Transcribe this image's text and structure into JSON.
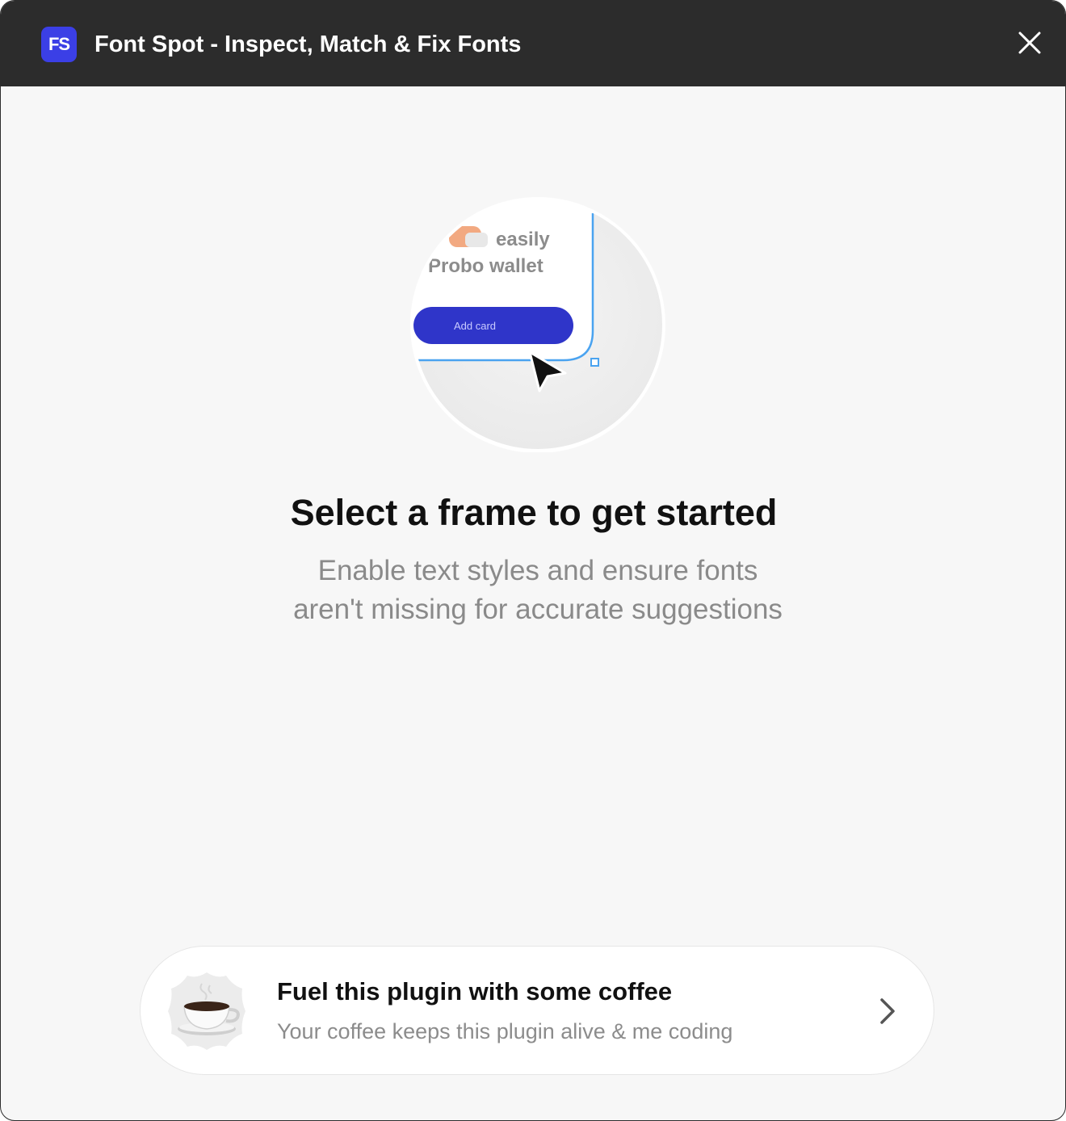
{
  "window": {
    "app_badge": "FS",
    "title": "Font Spot - Inspect, Match & Fix Fonts",
    "close_icon": "close-icon"
  },
  "illustration": {
    "text_line_1": "easily",
    "text_line_2": "Probo wallet",
    "button_label": "Add card"
  },
  "empty_state": {
    "heading": "Select a frame to get started",
    "subtext_line_1": "Enable text styles and ensure fonts",
    "subtext_line_2": "aren't missing for accurate suggestions"
  },
  "coffee_card": {
    "title": "Fuel this plugin with some coffee",
    "subtitle": "Your coffee keeps this plugin alive & me coding",
    "icon": "coffee-cup-icon",
    "chevron_icon": "chevron-right-icon"
  },
  "colors": {
    "titlebar": "#2c2c2c",
    "brand": "#3b3fe6",
    "background": "#f7f7f7",
    "selection": "#4aa3f0"
  }
}
